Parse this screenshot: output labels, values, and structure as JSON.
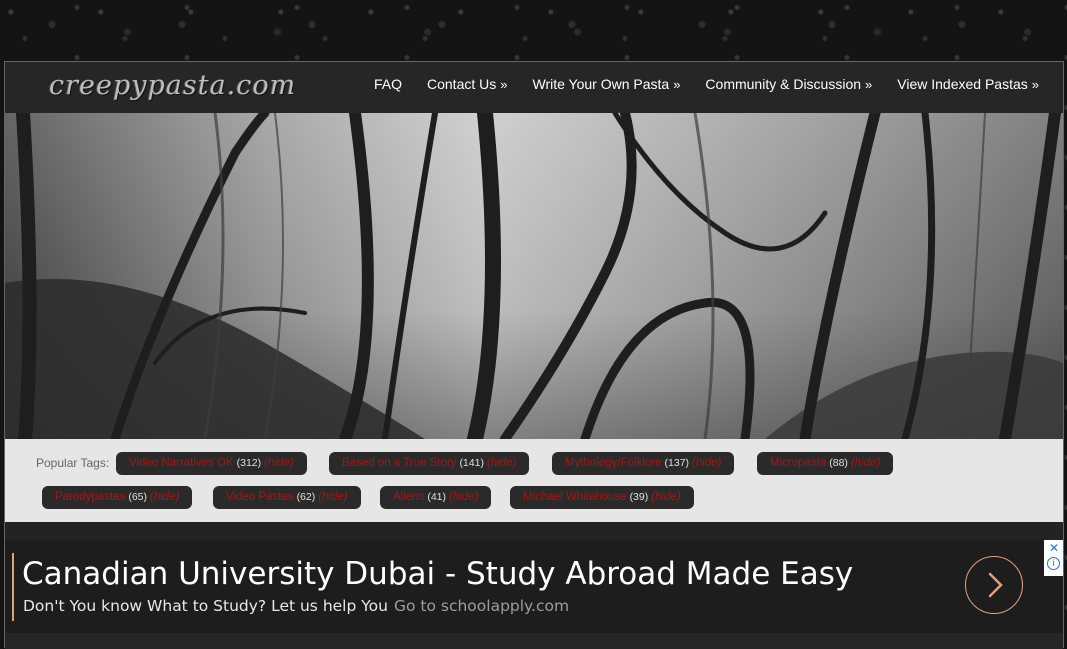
{
  "site": {
    "logo_text": "creepypasta.com"
  },
  "nav": {
    "items": [
      {
        "label": "FAQ",
        "arrow": ""
      },
      {
        "label": "Contact Us",
        "arrow": "»"
      },
      {
        "label": "Write Your Own Pasta",
        "arrow": "»"
      },
      {
        "label": "Community & Discussion",
        "arrow": "»"
      },
      {
        "label": "View Indexed Pastas",
        "arrow": "»"
      }
    ]
  },
  "popular_tags": {
    "label": "Popular Tags:",
    "tags": [
      {
        "name": "Video Narratives OK",
        "count": "(312)",
        "hide": "(hide)"
      },
      {
        "name": "Based on a True Story",
        "count": "(141)",
        "hide": "(hide)"
      },
      {
        "name": "Mythology/Folklore",
        "count": "(137)",
        "hide": "(hide)"
      },
      {
        "name": "Micropasta",
        "count": "(88)",
        "hide": "(hide)"
      },
      {
        "name": "Parodypastas",
        "count": "(65)",
        "hide": "(hide)"
      },
      {
        "name": "Video Pastas",
        "count": "(62)",
        "hide": "(hide)"
      },
      {
        "name": "Aliens",
        "count": "(41)",
        "hide": "(hide)"
      },
      {
        "name": "Michael Whitehouse",
        "count": "(39)",
        "hide": "(hide)"
      }
    ]
  },
  "ad": {
    "title": "Canadian University Dubai - Study Abroad Made Easy",
    "subtitle": "Don't You know What to Study? Let us help You",
    "link_text": "Go to schoolapply.com",
    "accent_color": "#d9a37f"
  },
  "colors": {
    "tag_text": "#a01818",
    "tag_bg": "#2a2a2a",
    "header_bg": "#262626"
  },
  "icons": {
    "ad_next": "chevron-right-icon",
    "adchoices": "adchoices-icon"
  }
}
